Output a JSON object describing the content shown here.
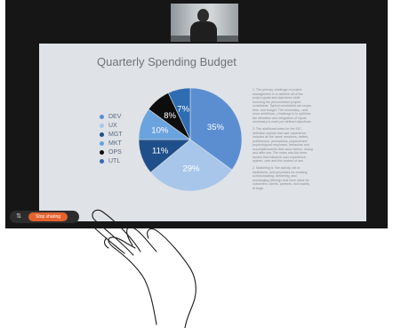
{
  "slide": {
    "title": "Quarterly Spending Budget",
    "legend": [
      {
        "label": "DEV",
        "color": "#5b8ed1"
      },
      {
        "label": "UX",
        "color": "#a8c6ea"
      },
      {
        "label": "MGT",
        "color": "#1f4f8a"
      },
      {
        "label": "MKT",
        "color": "#6aa3dd"
      },
      {
        "label": "OPS",
        "color": "#0d0d0d"
      },
      {
        "label": "UTL",
        "color": "#2f6db3"
      }
    ],
    "body_paragraphs": [
      "1. The primary challenge of project management is to achieve all of the project goals and objectives while honoring the preconceived project constraints. Typical constraints are scope, time, and budget. The secondary—and more ambitious—challenge is to optimize the allocation and integration of inputs necessary to meet pre-defined objectives.",
      "3. The additional notes for the IDC definition explain that user experience includes all the users' emotions, beliefs, preferences, perceptions, physical and psychological responses, behaviors and accomplishments that occur before, during and after use. The notes also list three factors that influence user experience: system, user and the context of use.",
      "2. Marketing is \"the activity, set of institutions, and processes for creating, communicating, delivering, and exchanging offerings that have value for customers, clients, partners, and society at large."
    ]
  },
  "chart_data": {
    "type": "pie",
    "categories": [
      "DEV",
      "UX",
      "MGT",
      "MKT",
      "OPS",
      "UTL"
    ],
    "values": [
      35,
      29,
      11,
      10,
      8,
      7
    ],
    "value_labels": [
      "35%",
      "29%",
      "11%",
      "10%",
      "8%",
      "7%"
    ],
    "colors": [
      "#5b8ed1",
      "#a8c6ea",
      "#1f4f8a",
      "#6aa3dd",
      "#0d0d0d",
      "#2f6db3"
    ],
    "title": "Quarterly Spending Budget",
    "legend_position": "left"
  },
  "toolbar": {
    "stop_sharing_label": "Stop sharing",
    "share_icon": "screen-share-icon"
  },
  "overlay": {
    "gesture": "hand-tap-gesture"
  }
}
